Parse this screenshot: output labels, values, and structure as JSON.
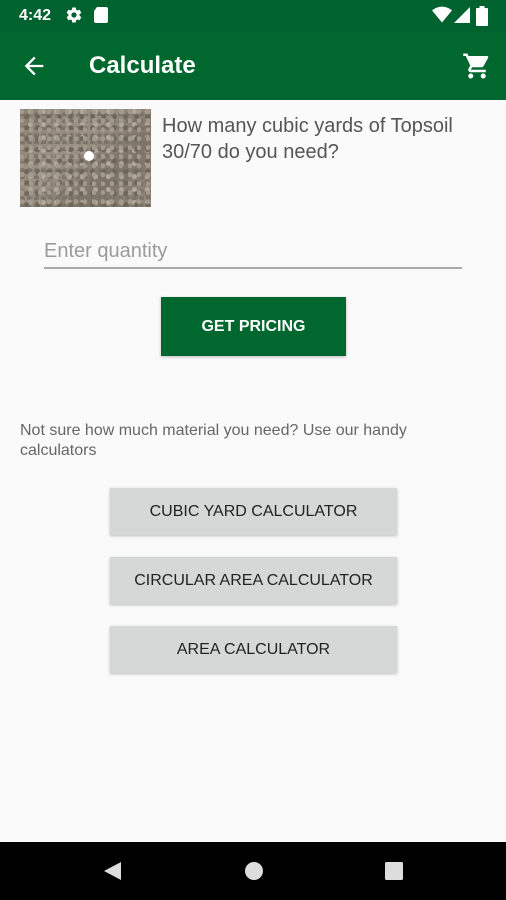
{
  "status_bar": {
    "time": "4:42",
    "icons": [
      "settings-icon",
      "sd-card-icon",
      "wifi-icon",
      "signal-icon",
      "battery-icon"
    ]
  },
  "app_bar": {
    "title": "Calculate",
    "back_icon": "arrow-back-icon",
    "cart_icon": "shopping-cart-icon",
    "background": "#00672f"
  },
  "product": {
    "image": "topsoil-image",
    "question": "How many cubic yards of Topsoil 30/70 do you need?"
  },
  "quantity_input": {
    "value": "",
    "placeholder": "Enter quantity"
  },
  "pricing_button": {
    "label": "GET PRICING"
  },
  "helper_text": "Not sure how much material you need? Use our handy calculators",
  "calculators": [
    {
      "label": "CUBIC YARD CALCULATOR"
    },
    {
      "label": "CIRCULAR AREA CALCULATOR"
    },
    {
      "label": "AREA CALCULATOR"
    }
  ],
  "nav_bar": {
    "icons": [
      "back-triangle-icon",
      "home-circle-icon",
      "recents-square-icon"
    ]
  }
}
